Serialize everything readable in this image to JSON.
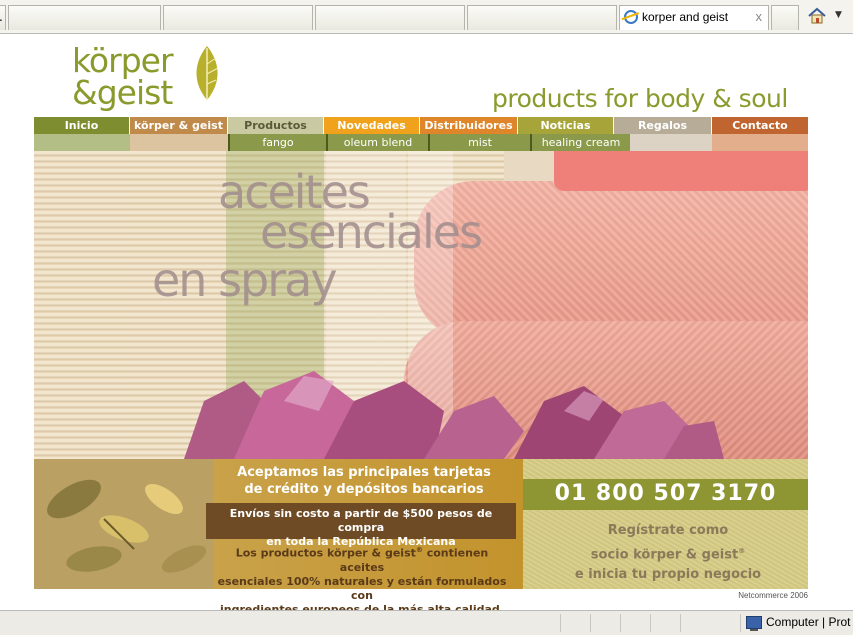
{
  "browser": {
    "tabs": [
      {
        "title": "",
        "active": false
      },
      {
        "title": "",
        "active": false
      },
      {
        "title": "",
        "active": false
      },
      {
        "title": "",
        "active": false
      },
      {
        "title": "korper and geist",
        "active": true,
        "close": "x"
      },
      {
        "title": "",
        "active": false
      }
    ],
    "home_icon": "home-icon",
    "home_dropdown": "▼"
  },
  "logo": {
    "line1": "körper",
    "line2": "&geist",
    "icon": "leaf-icon"
  },
  "tagline": "products for body & soul",
  "nav": {
    "items": [
      {
        "label": "Inicio",
        "color": "#7e8d2f"
      },
      {
        "label": "körper & geist",
        "color": "#c08a4a"
      },
      {
        "label": "Productos",
        "color": "#c9c9a2"
      },
      {
        "label": "Novedades",
        "color": "#f0a21c"
      },
      {
        "label": "Distribuidores",
        "color": "#e0862a"
      },
      {
        "label": "Noticias",
        "color": "#a7a53a"
      },
      {
        "label": "Regalos",
        "color": "#b7ac98"
      },
      {
        "label": "Contacto",
        "color": "#c0652f"
      }
    ],
    "subitems": [
      {
        "label": "fango"
      },
      {
        "label": "oleum blend"
      },
      {
        "label": "mist"
      },
      {
        "label": "healing cream"
      }
    ]
  },
  "hero": {
    "line1": "aceites",
    "line2": "esenciales",
    "line3": "en spray"
  },
  "promo": {
    "headline_line1": "Aceptamos las principales tarjetas",
    "headline_line2": "de crédito y depósitos bancarios",
    "shipping_line1": "Envíos sin costo a partir de $500 pesos de compra",
    "shipping_line2": "en toda la República Mexicana",
    "body_line1a": "Los productos körper & geist",
    "body_reg": "®",
    "body_line1b": " contienen aceites",
    "body_line2": "esenciales 100% naturales y están formulados con",
    "body_line3": "ingredientes europeos de la más alta calidad."
  },
  "signup": {
    "phone": "01 800 507 3170",
    "line1": "Regístrate como",
    "line2a": "socio körper & geist",
    "line2_reg": "®",
    "line3": "e inicia tu propio negocio"
  },
  "footer_credit": "Netcommerce 2006",
  "statusbar": {
    "zone": "Computer | Prot"
  },
  "colors": {
    "brand_green": "#8a9a2c",
    "phone_bar": "#8e9634"
  }
}
